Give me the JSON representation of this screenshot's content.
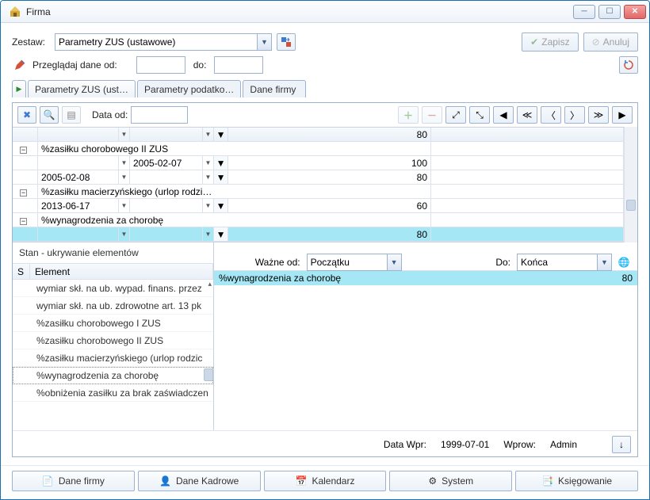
{
  "window": {
    "title": "Firma"
  },
  "top": {
    "zestaw_label": "Zestaw:",
    "zestaw_value": "Parametry ZUS (ustawowe)",
    "save": "Zapisz",
    "cancel": "Anuluj",
    "browse_label": "Przeglądaj dane od:",
    "to_label": "do:"
  },
  "tabs": [
    "Parametry ZUS (ust…",
    "Parametry podatko…",
    "Dane firmy"
  ],
  "grid": {
    "data_od_label": "Data od:",
    "rows": [
      {
        "type": "hdr",
        "val": "80"
      },
      {
        "type": "group",
        "label": "%zasiłku chorobowego II ZUS"
      },
      {
        "type": "data",
        "c1": "",
        "c2": "2005-02-07",
        "val": "100"
      },
      {
        "type": "data",
        "c1": "2005-02-08",
        "c2": "",
        "val": "80"
      },
      {
        "type": "group",
        "label": "%zasiłku macierzyńskiego (urlop rodzi…"
      },
      {
        "type": "data",
        "c1": "2013-06-17",
        "c2": "",
        "val": "60"
      },
      {
        "type": "group",
        "label": "%wynagrodzenia za chorobę"
      },
      {
        "type": "data",
        "c1": "",
        "c2": "",
        "val": "80",
        "hl": true
      }
    ]
  },
  "hide": {
    "title": "Stan - ukrywanie elementów",
    "col_s": "S",
    "col_e": "Element",
    "items": [
      "wymiar skł. na ub. wypad. finans. przez",
      "wymiar skł. na ub. zdrowotne art. 13 pk",
      "%zasiłku chorobowego I ZUS",
      "%zasiłku chorobowego II ZUS",
      "%zasiłku macierzyńskiego (urlop rodzic",
      "%wynagrodzenia za chorobę",
      "%obniżenia zasiłku za brak zaświadczen"
    ],
    "selected_index": 5
  },
  "detail": {
    "from_label": "Ważne od:",
    "from_value": "Początku",
    "to_label": "Do:",
    "to_value": "Końca",
    "row_label": "%wynagrodzenia za chorobę",
    "row_value": "80"
  },
  "status": {
    "date_label": "Data Wpr:",
    "date_value": "1999-07-01",
    "user_label": "Wprow:",
    "user_value": "Admin"
  },
  "bottom": [
    "Dane firmy",
    "Dane Kadrowe",
    "Kalendarz",
    "System",
    "Księgowanie"
  ],
  "chart_data": {
    "type": "table",
    "title": "Parametry ZUS (ustawowe)",
    "series": [
      {
        "name": "%zasiłku chorobowego II ZUS",
        "rows": [
          {
            "from": "",
            "to": "2005-02-07",
            "value": 100
          },
          {
            "from": "2005-02-08",
            "to": "",
            "value": 80
          }
        ]
      },
      {
        "name": "%zasiłku macierzyńskiego (urlop rodzicielski)",
        "rows": [
          {
            "from": "2013-06-17",
            "to": "",
            "value": 60
          }
        ]
      },
      {
        "name": "%wynagrodzenia za chorobę",
        "rows": [
          {
            "from": "",
            "to": "",
            "value": 80
          }
        ]
      }
    ]
  }
}
